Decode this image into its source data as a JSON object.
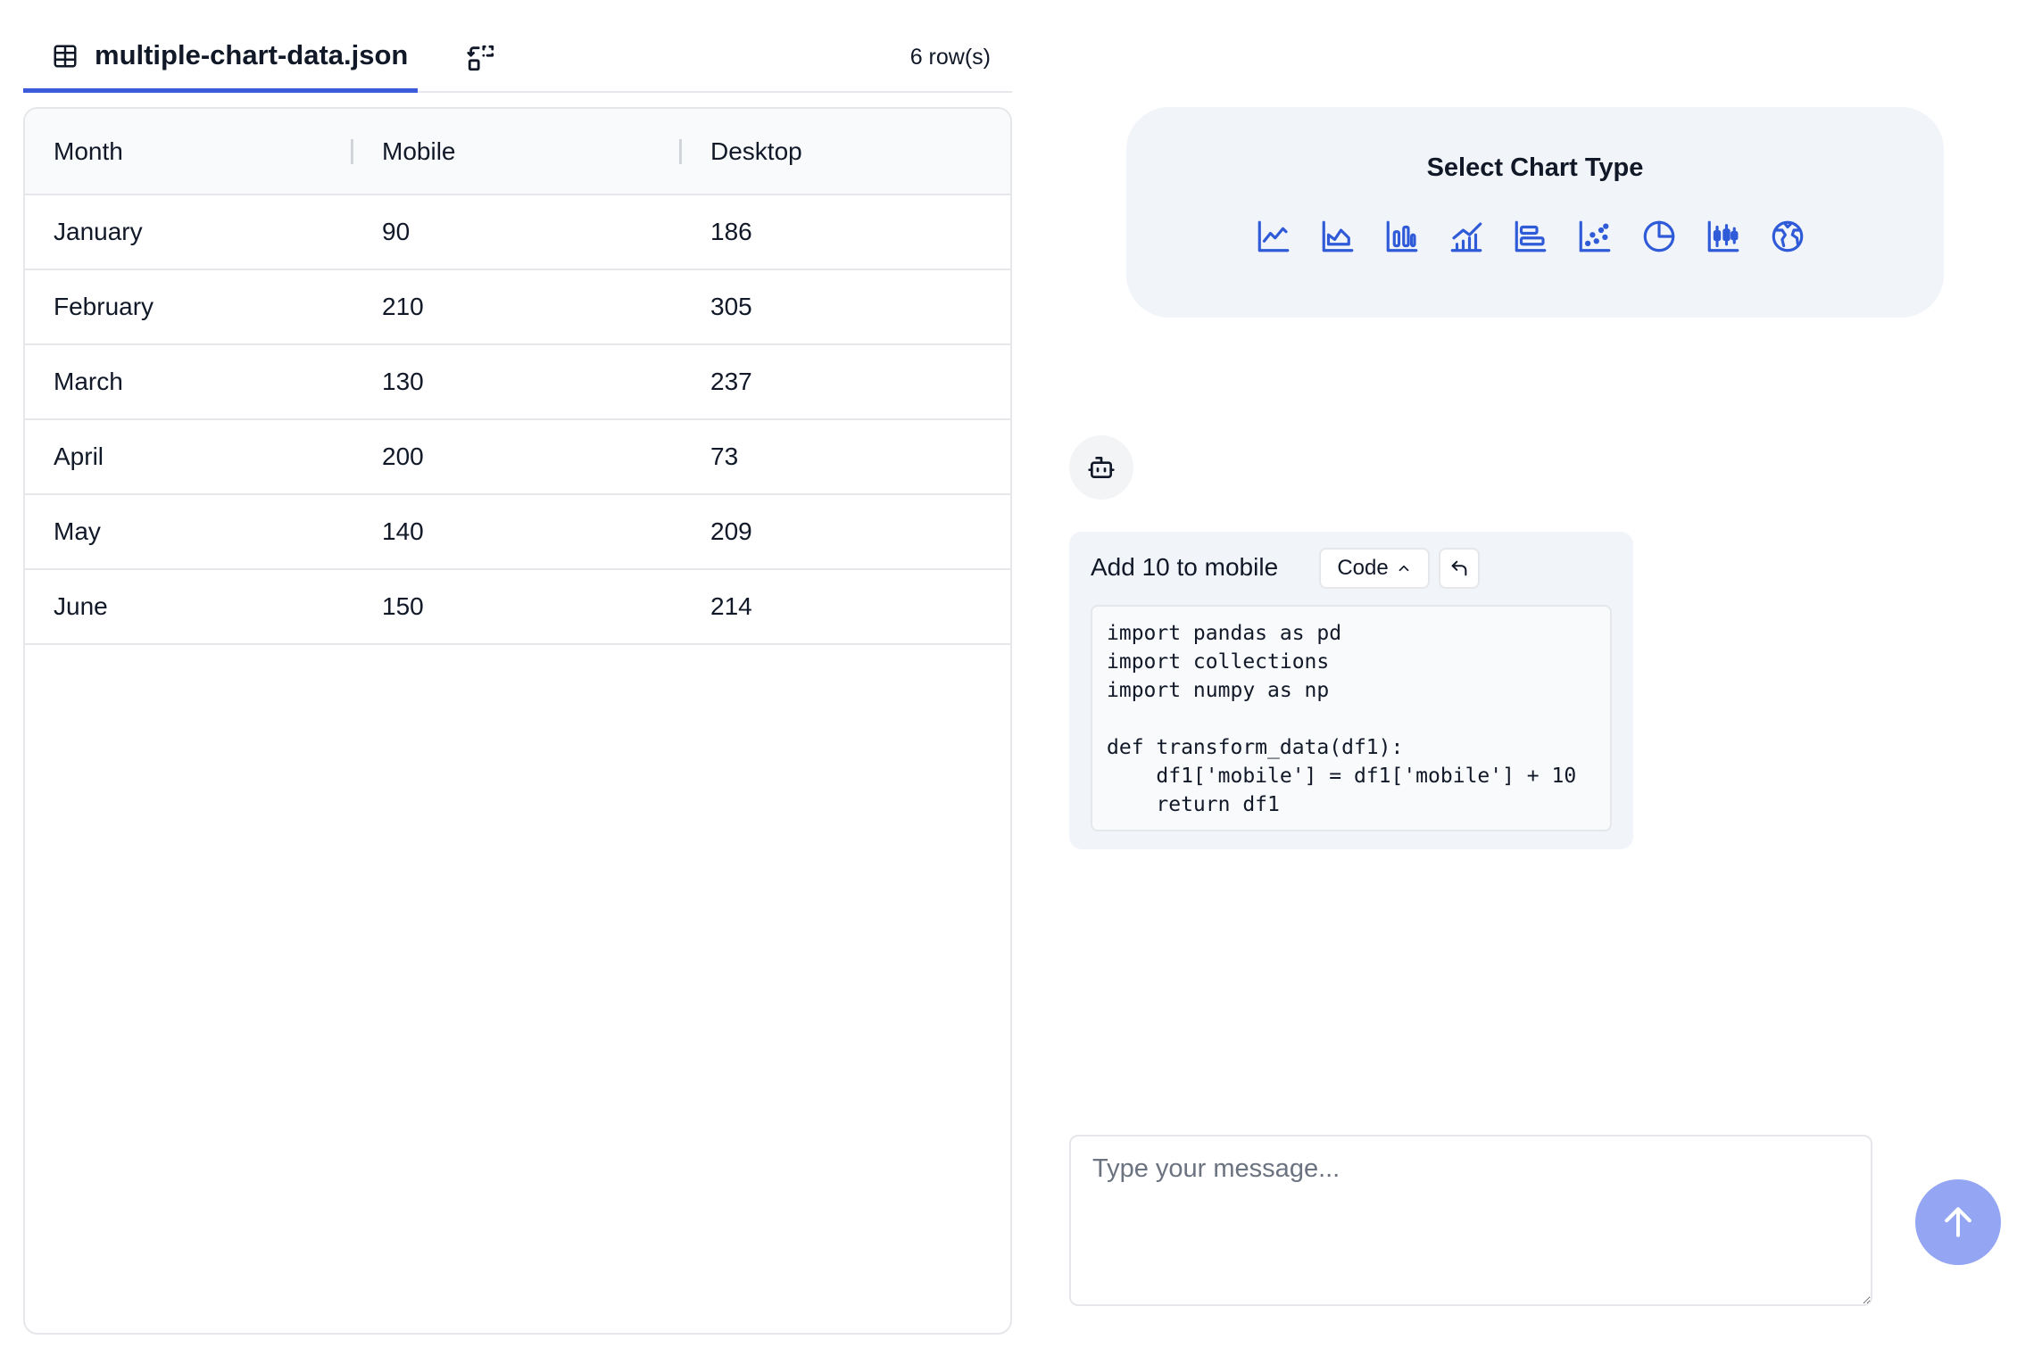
{
  "tabs": {
    "active_label": "multiple-chart-data.json",
    "row_count": "6 row(s)"
  },
  "table": {
    "columns": [
      "Month",
      "Mobile",
      "Desktop"
    ],
    "rows": [
      [
        "January",
        "90",
        "186"
      ],
      [
        "February",
        "210",
        "305"
      ],
      [
        "March",
        "130",
        "237"
      ],
      [
        "April",
        "200",
        "73"
      ],
      [
        "May",
        "140",
        "209"
      ],
      [
        "June",
        "150",
        "214"
      ]
    ]
  },
  "chart_select": {
    "title": "Select Chart Type",
    "icons": [
      "line-chart-icon",
      "area-chart-icon",
      "bar-chart-icon",
      "line-bar-chart-icon",
      "horizontal-bar-chart-icon",
      "scatter-chart-icon",
      "pie-chart-icon",
      "candlestick-chart-icon",
      "map-globe-icon"
    ]
  },
  "message": {
    "text": "Add 10 to mobile",
    "code_button_label": "Code",
    "code": "import pandas as pd\nimport collections\nimport numpy as np\n\ndef transform_data(df1):\n    df1['mobile'] = df1['mobile'] + 10\n    return df1"
  },
  "composer": {
    "placeholder": "Type your message..."
  },
  "colors": {
    "accent": "#3b5bdb",
    "icon_blue": "#2f5ad8",
    "send_button": "#93a5f3",
    "card_bg": "#f1f4f9"
  }
}
